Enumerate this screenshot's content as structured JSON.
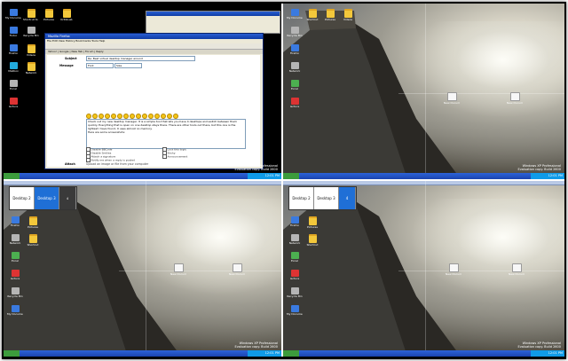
{
  "screen": {
    "desktops": {
      "q1": {
        "icons": [
          "My Documents",
          "Shortcut to ..",
          "Pictures",
          "KritikLab",
          "Fodor",
          "Recycle Bin",
          "Firefox",
          "Videos",
          "Mailbox",
          "Network",
          "Excel",
          "lecture"
        ],
        "browser": {
          "title": "Mozilla Firefox",
          "menu": "File  Edit  View  History  Bookmarks  Tools  Help",
          "tabs": "Yahoo!  |  Google  |  New Tab  |  Forum  |  Reply",
          "subject_label": "Subject",
          "subject_value": "Re: Best virtual desktop manager around",
          "message_label": "Message",
          "font_select": "Font",
          "size_select": "Size",
          "body_text": "Check out my new desktop manager. It is a simple tool that lets you have 4 desktops and switch between them quickly. Everything that is open on one desktop stays there. There are other tools out there, but this one is the lightest I have found, it uses almost no memory.",
          "body_text_2": "Here are some screenshots:",
          "options": [
            "Disable BBCode",
            "Disable Smilies",
            "Attach a signature",
            "Notify me when a reply is posted",
            "Lock this topic",
            "Sticky",
            "Announcement"
          ],
          "attach_label": "Attach",
          "bottom_note": "Upload an image or file from your computer"
        },
        "watermark_line1": "Windows XP Professional",
        "watermark_line2": "Evaluation copy. Build 2600"
      },
      "q2": {
        "icons": [
          "My Documents",
          "Recycle Bin",
          "Firefox",
          "Network",
          "Excel",
          "lecture",
          "Shortcut",
          "Pictures",
          "Videos"
        ],
        "doc_icons": [
          "New Document",
          "New Document"
        ],
        "watermark_line1": "Windows XP Professional",
        "watermark_line2": "Evaluation copy. Build 2600"
      },
      "q3": {
        "switcher": [
          "Desktop 2",
          "Desktop 3",
          "4"
        ],
        "active_desktop": "Desktop 3",
        "icons": [
          "My Documents",
          "Firefox",
          "Network",
          "Excel",
          "Pictures",
          "Recycle Bin",
          "Shortcut",
          "lecture"
        ],
        "doc_icons": [
          "New Document",
          "New Document"
        ],
        "watermark_line1": "Windows XP Professional",
        "watermark_line2": "Evaluation copy. Build 2600"
      },
      "q4": {
        "switcher": [
          "Desktop 2",
          "Desktop 3",
          "4"
        ],
        "active_desktop": "4",
        "icons": [
          "My Documents",
          "Firefox",
          "Network",
          "Excel",
          "Pictures",
          "Recycle Bin",
          "Shortcut",
          "lecture"
        ],
        "doc_icons": [
          "New Document",
          "New Document"
        ],
        "watermark_line1": "Windows XP Professional",
        "watermark_line2": "Evaluation copy. Build 2600"
      }
    },
    "clock": "12:01 PM",
    "colors": {
      "taskbar": "#1a44b0",
      "start": "#3c9c3c",
      "switcher_active": "#1f6fd6"
    }
  }
}
